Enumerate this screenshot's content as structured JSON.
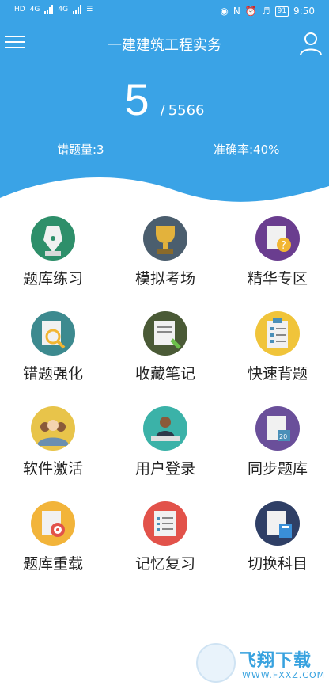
{
  "status_bar": {
    "time": "9:50",
    "battery": "91",
    "net_left": [
      "HD",
      "HD",
      "4G",
      "4G"
    ]
  },
  "header": {
    "title": "一建建筑工程实务",
    "progress_current": "5",
    "progress_separator": "/",
    "progress_total": "5566",
    "wrong_count": "错题量:3",
    "accuracy": "准确率:40%"
  },
  "grid": {
    "items": [
      {
        "label": "题库练习",
        "icon": "pen-nib-icon",
        "color": "#2e8f6a"
      },
      {
        "label": "模拟考场",
        "icon": "trophy-icon",
        "color": "#4b5e6e"
      },
      {
        "label": "精华专区",
        "icon": "question-doc-icon",
        "color": "#6a3d8f"
      },
      {
        "label": "错题强化",
        "icon": "magnify-doc-icon",
        "color": "#3d8a8f"
      },
      {
        "label": "收藏笔记",
        "icon": "notebook-icon",
        "color": "#4a5a36"
      },
      {
        "label": "快速背题",
        "icon": "clipboard-icon",
        "color": "#f0c43a"
      },
      {
        "label": "软件激活",
        "icon": "people-icon",
        "color": "#e8c44a"
      },
      {
        "label": "用户登录",
        "icon": "user-desk-icon",
        "color": "#3bb2a8"
      },
      {
        "label": "同步题库",
        "icon": "calendar-doc-icon",
        "color": "#6a4f9a"
      },
      {
        "label": "题库重载",
        "icon": "target-doc-icon",
        "color": "#f2b43a"
      },
      {
        "label": "记忆复习",
        "icon": "checklist-icon",
        "color": "#e2524a"
      },
      {
        "label": "切换科目",
        "icon": "calculator-doc-icon",
        "color": "#2f3f66"
      }
    ]
  },
  "watermark": {
    "text": "飞翔下载",
    "url": "WWW.FXXZ.COM"
  }
}
